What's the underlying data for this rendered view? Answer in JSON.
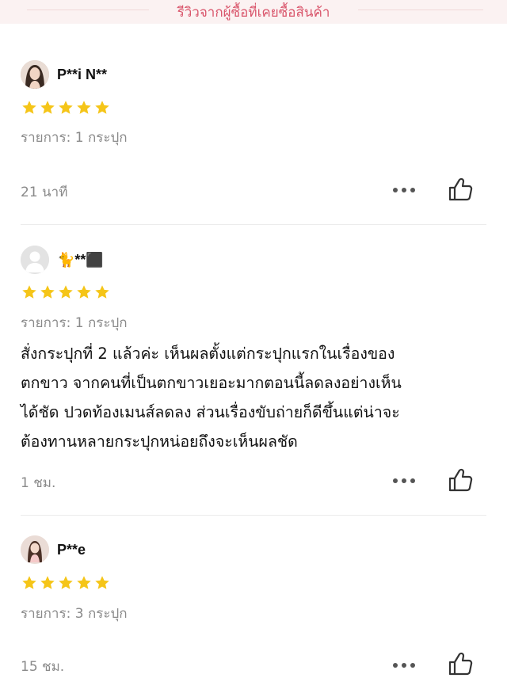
{
  "header": {
    "title": "รีวิวจากผู้ซื้อที่เคยซื้อสินค้า"
  },
  "colors": {
    "accent": "#d9556b",
    "star": "#f5c518",
    "muted": "#8a8a8a"
  },
  "reviews": [
    {
      "username": "P**i N**",
      "avatar": "avatar-woman-photo",
      "rating": 5,
      "item": "รายการ: 1 กระปุก",
      "text": "",
      "time": "21 นาที",
      "more_icon": "more-dots-icon",
      "like_icon": "thumbs-up-icon"
    },
    {
      "username": "🐈**⬛",
      "avatar": "avatar-default-grey",
      "rating": 5,
      "item": "รายการ: 1 กระปุก",
      "text_lines": [
        "สั่งกระปุกที่ 2 แล้วค่ะ เห็นผลตั้งแต่กระปุกแรกในเรื่องของ",
        "ตกขาว จากคนที่เป็นตกขาวเยอะมากตอนนี้ลดลงอย่างเห็น",
        "ได้ชัด ปวดท้องเมนส์ลดลง ส่วนเรื่องขับถ่ายก็ดีขึ้นแต่น่าจะ",
        "ต้องทานหลายกระปุกหน่อยถึงจะเห็นผลชัด"
      ],
      "time": "1 ชม.",
      "more_icon": "more-dots-icon",
      "like_icon": "thumbs-up-icon"
    },
    {
      "username": "P**e",
      "avatar": "avatar-woman-photo-2",
      "rating": 5,
      "item": "รายการ: 3 กระปุก",
      "text": "",
      "time": "15 ชม.",
      "more_icon": "more-dots-icon",
      "like_icon": "thumbs-up-icon"
    }
  ]
}
